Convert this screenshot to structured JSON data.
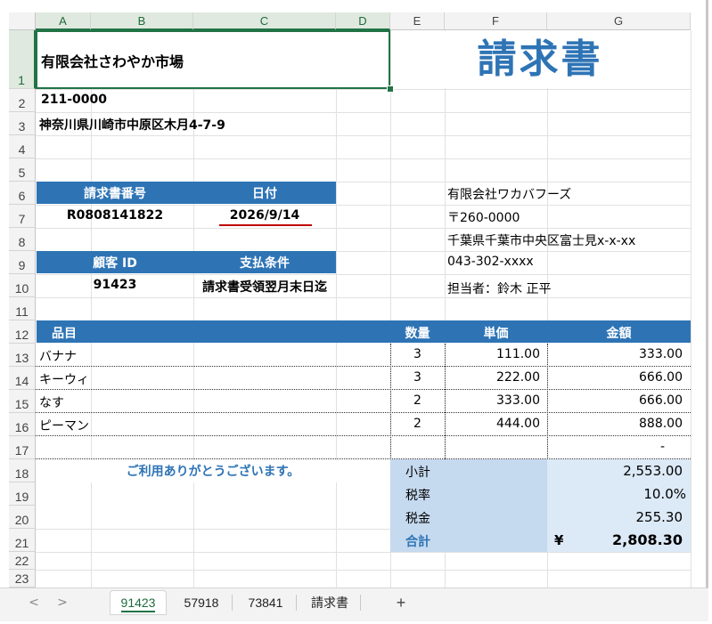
{
  "columns": [
    "A",
    "B",
    "C",
    "D",
    "E",
    "F",
    "G"
  ],
  "rows": [
    "1",
    "2",
    "3",
    "4",
    "5",
    "6",
    "7",
    "8",
    "9",
    "10",
    "11",
    "12",
    "13",
    "14",
    "15",
    "16",
    "17",
    "18",
    "19",
    "20",
    "21",
    "22",
    "23"
  ],
  "seller": {
    "company": "有限会社さわやか市場",
    "postal": "211-0000",
    "address": "神奈川県川崎市中原区木月4-7-9"
  },
  "title": "請求書",
  "invoice": {
    "number_label": "請求書番号",
    "date_label": "日付",
    "number": "R0808141822",
    "date": "2026/9/14",
    "customer_id_label": "顧客 ID",
    "payment_terms_label": "支払条件",
    "customer_id": "91423",
    "payment_terms": "請求書受領翌月末日迄"
  },
  "recipient": {
    "company": "有限会社ワカバフーズ",
    "postal": "〒260-0000",
    "address": "千葉県千葉市中央区富士見x-x-xx",
    "phone": "043-302-xxxx",
    "contact": "担当者：鈴木 正平"
  },
  "items_header": {
    "item": "品目",
    "qty": "数量",
    "unit_price": "単価",
    "amount": "金額"
  },
  "items": [
    {
      "name": "バナナ",
      "qty": "3",
      "price": "111.00",
      "amount": "333.00"
    },
    {
      "name": "キーウィ",
      "qty": "3",
      "price": "222.00",
      "amount": "666.00"
    },
    {
      "name": "なす",
      "qty": "2",
      "price": "333.00",
      "amount": "666.00"
    },
    {
      "name": "ピーマン",
      "qty": "2",
      "price": "444.00",
      "amount": "888.00"
    },
    {
      "name": "",
      "qty": "",
      "price": "",
      "amount": "-"
    }
  ],
  "thanks": "ご利用ありがとうございます。",
  "totals": {
    "subtotal_label": "小計",
    "subtotal": "2,553.00",
    "tax_rate_label": "税率",
    "tax_rate": "10.0%",
    "tax_label": "税金",
    "tax": "255.30",
    "total_label": "合計",
    "currency": "¥",
    "total": "2,808.30"
  },
  "tabs": [
    "91423",
    "57918",
    "73841",
    "請求書"
  ],
  "add_sheet": "+",
  "colors": {
    "accent": "#2e74b5",
    "light": "#c5d9ef",
    "lighter": "#dce9f6",
    "excel_green": "#217346",
    "red": "#c00000"
  }
}
